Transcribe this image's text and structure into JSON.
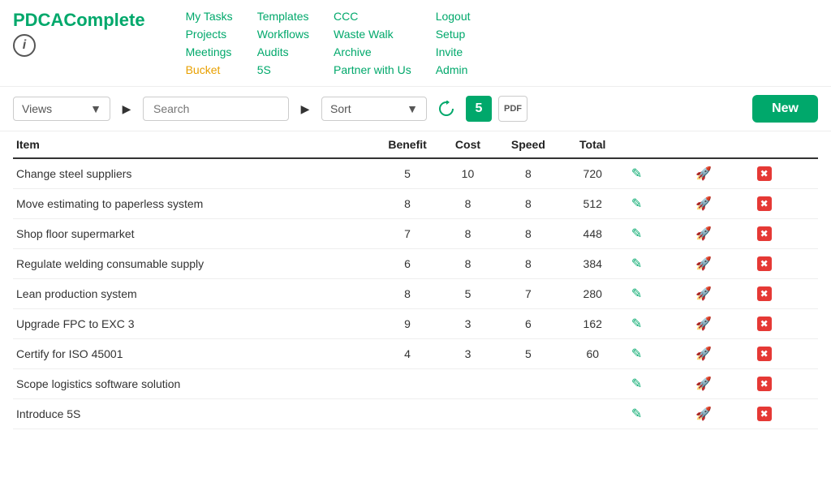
{
  "logo": {
    "text1": "PDCA",
    "text2": "Complete"
  },
  "infoIcon": "i",
  "nav": {
    "col1": [
      {
        "label": "My Tasks",
        "active": false
      },
      {
        "label": "Projects",
        "active": false
      },
      {
        "label": "Meetings",
        "active": false
      },
      {
        "label": "Bucket",
        "active": true
      }
    ],
    "col2": [
      {
        "label": "Templates",
        "active": false
      },
      {
        "label": "Workflows",
        "active": false
      },
      {
        "label": "Audits",
        "active": false
      },
      {
        "label": "5S",
        "active": false
      }
    ],
    "col3": [
      {
        "label": "CCC",
        "active": false
      },
      {
        "label": "Waste Walk",
        "active": false
      },
      {
        "label": "Archive",
        "active": false
      },
      {
        "label": "Partner with Us",
        "active": false
      }
    ],
    "col4": [
      {
        "label": "Logout",
        "active": false
      },
      {
        "label": "Setup",
        "active": false
      },
      {
        "label": "Invite",
        "active": false
      },
      {
        "label": "Admin",
        "active": false
      }
    ]
  },
  "toolbar": {
    "views_label": "Views",
    "views_placeholder": "Views",
    "search_placeholder": "Search",
    "sort_placeholder": "Sort",
    "badge_number": "5",
    "pdf_label": "PDF",
    "new_label": "New"
  },
  "table": {
    "headers": [
      "Item",
      "Benefit",
      "Cost",
      "Speed",
      "Total",
      "",
      "",
      ""
    ],
    "rows": [
      {
        "item": "Change steel suppliers",
        "benefit": "5",
        "cost": "10",
        "speed": "8",
        "total": "720"
      },
      {
        "item": "Move estimating to paperless system",
        "benefit": "8",
        "cost": "8",
        "speed": "8",
        "total": "512"
      },
      {
        "item": "Shop floor supermarket",
        "benefit": "7",
        "cost": "8",
        "speed": "8",
        "total": "448"
      },
      {
        "item": "Regulate welding consumable supply",
        "benefit": "6",
        "cost": "8",
        "speed": "8",
        "total": "384"
      },
      {
        "item": "Lean production system",
        "benefit": "8",
        "cost": "5",
        "speed": "7",
        "total": "280"
      },
      {
        "item": "Upgrade FPC to EXC 3",
        "benefit": "9",
        "cost": "3",
        "speed": "6",
        "total": "162"
      },
      {
        "item": "Certify for ISO 45001",
        "benefit": "4",
        "cost": "3",
        "speed": "5",
        "total": "60"
      },
      {
        "item": "Scope logistics software solution",
        "benefit": "",
        "cost": "",
        "speed": "",
        "total": ""
      },
      {
        "item": "Introduce 5S",
        "benefit": "",
        "cost": "",
        "speed": "",
        "total": ""
      }
    ]
  },
  "colors": {
    "green": "#00a86b",
    "active_nav": "#e8a000",
    "delete_red": "#e53935"
  }
}
